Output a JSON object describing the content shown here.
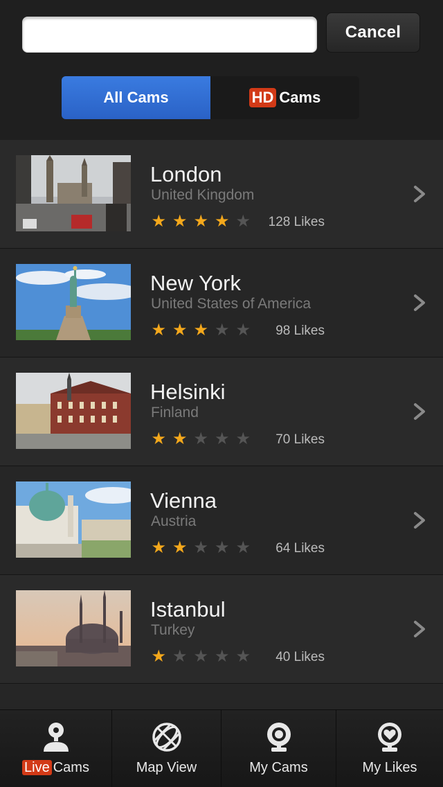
{
  "search": {
    "value": "",
    "placeholder": ""
  },
  "header": {
    "cancel_label": "Cancel"
  },
  "segments": {
    "all_label": "All Cams",
    "hd_badge": "HD",
    "hd_label": "Cams"
  },
  "cams": [
    {
      "city": "London",
      "country": "United Kingdom",
      "rating": 4,
      "likes": "128 Likes"
    },
    {
      "city": "New York",
      "country": "United States of America",
      "rating": 3,
      "likes": "98 Likes"
    },
    {
      "city": "Helsinki",
      "country": "Finland",
      "rating": 2,
      "likes": "70 Likes"
    },
    {
      "city": "Vienna",
      "country": "Austria",
      "rating": 2,
      "likes": "64 Likes"
    },
    {
      "city": "Istanbul",
      "country": "Turkey",
      "rating": 1,
      "likes": "40 Likes"
    }
  ],
  "tabbar": {
    "live_badge": "Live",
    "live_label": "Cams",
    "map_label": "Map View",
    "mycams_label": "My Cams",
    "mylikes_label": "My Likes"
  },
  "colors": {
    "accent": "#2a62c6",
    "badge": "#d23a17",
    "star_on": "#f4a81c",
    "star_off": "#555555"
  },
  "icons": [
    "chevron-right-icon",
    "star-icon",
    "person-icon",
    "globe-icon",
    "webcam-icon",
    "heart-webcam-icon"
  ]
}
